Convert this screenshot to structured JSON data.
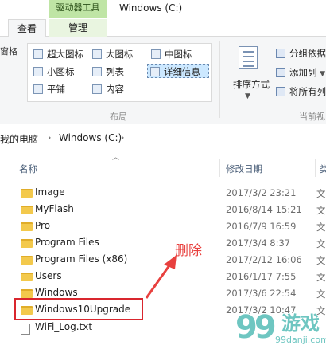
{
  "window": {
    "context_tab_label": "驱动器工具",
    "title": "Windows (C:)"
  },
  "tabs": [
    {
      "label": "查看"
    },
    {
      "label": "管理"
    }
  ],
  "ribbon": {
    "left_pane_label": "窗格",
    "layout": {
      "items": [
        {
          "label": "超大图标"
        },
        {
          "label": "大图标"
        },
        {
          "label": "中图标"
        },
        {
          "label": "小图标"
        },
        {
          "label": "列表"
        },
        {
          "label": "详细信息"
        },
        {
          "label": "平铺"
        },
        {
          "label": "内容"
        }
      ],
      "group_label": "布局",
      "selected": "详细信息"
    },
    "sort_by_label": "排序方式",
    "current_view": {
      "items": [
        {
          "label": "分组依据"
        },
        {
          "label": "添加列"
        },
        {
          "label": "将所有列"
        }
      ],
      "group_label": "当前视"
    }
  },
  "address": {
    "crumbs": [
      "我的电脑",
      "Windows (C:)"
    ]
  },
  "columns": {
    "name": "名称",
    "date": "修改日期",
    "type": "类"
  },
  "files": [
    {
      "name": "Image",
      "date": "2017/3/2 23:21",
      "kind": "文",
      "icon": "folder-icon"
    },
    {
      "name": "MyFlash",
      "date": "2016/8/14 15:21",
      "kind": "文",
      "icon": "folder-icon"
    },
    {
      "name": "Pro",
      "date": "2016/7/9 16:59",
      "kind": "文",
      "icon": "folder-icon"
    },
    {
      "name": "Program Files",
      "date": "2017/3/4 8:37",
      "kind": "文",
      "icon": "folder-icon"
    },
    {
      "name": "Program Files (x86)",
      "date": "2017/2/12 16:06",
      "kind": "文",
      "icon": "folder-icon"
    },
    {
      "name": "Users",
      "date": "2016/1/17 7:55",
      "kind": "文",
      "icon": "folder-icon"
    },
    {
      "name": "Windows",
      "date": "2017/3/6 22:54",
      "kind": "文",
      "icon": "folder-icon"
    },
    {
      "name": "Windows10Upgrade",
      "date": "2017/3/2 10:47",
      "kind": "文",
      "icon": "folder-icon"
    },
    {
      "name": "WiFi_Log.txt",
      "date": "",
      "kind": "",
      "icon": "text-file-icon"
    }
  ],
  "annotation": {
    "text": "删除",
    "color": "#e8403e"
  },
  "watermark": {
    "logo": "99",
    "text": "游戏",
    "url": "99danji.com"
  }
}
